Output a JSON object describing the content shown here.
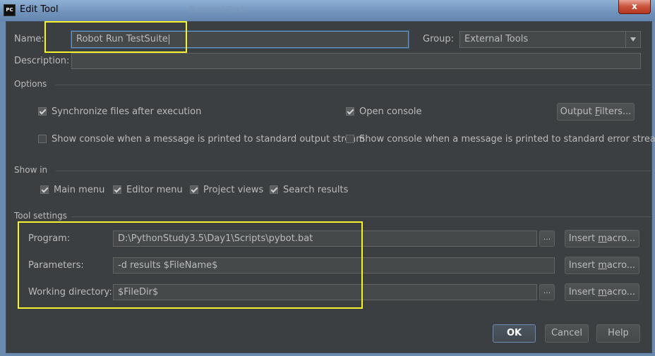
{
  "window": {
    "app_icon_text": "PC",
    "title": "Edit Tool",
    "ghost_title": "External Tools",
    "close_glyph": "x"
  },
  "name": {
    "label": "Name:",
    "value": "Robot Run TestSuite"
  },
  "group": {
    "label": "Group:",
    "value": "External Tools"
  },
  "description": {
    "label": "Description:",
    "value": ""
  },
  "options": {
    "title": "Options",
    "sync_files": {
      "label": "Synchronize files after execution",
      "checked": true
    },
    "open_console": {
      "label": "Open console",
      "checked": true
    },
    "output_filters": {
      "label_pre": "Output ",
      "label_mnemonic": "F",
      "label_post": "ilters..."
    },
    "show_console_stdout": {
      "label": "Show console when a message is printed to standard output stream",
      "checked": false
    },
    "show_console_stderr": {
      "label": "Show console when a message is printed to standard error stream",
      "checked": false
    }
  },
  "show_in": {
    "title": "Show in",
    "main_menu": {
      "label": "Main menu",
      "checked": true
    },
    "editor_menu": {
      "label": "Editor menu",
      "checked": true
    },
    "project_views": {
      "label": "Project views",
      "checked": true
    },
    "search_results": {
      "label": "Search results",
      "checked": true
    }
  },
  "tool_settings": {
    "title": "Tool settings",
    "program": {
      "label": "Program:",
      "value": "D:\\PythonStudy3.5\\Day1\\Scripts\\pybot.bat"
    },
    "parameters": {
      "label": "Parameters:",
      "value": "-d results $FileName$"
    },
    "working_directory": {
      "label": "Working directory:",
      "value": "$FileDir$"
    },
    "browse_label": "...",
    "insert_macro": {
      "pre": "Insert ",
      "mnemonic": "m",
      "post": "acro..."
    }
  },
  "buttons": {
    "ok": "OK",
    "cancel": "Cancel",
    "help": "Help"
  }
}
